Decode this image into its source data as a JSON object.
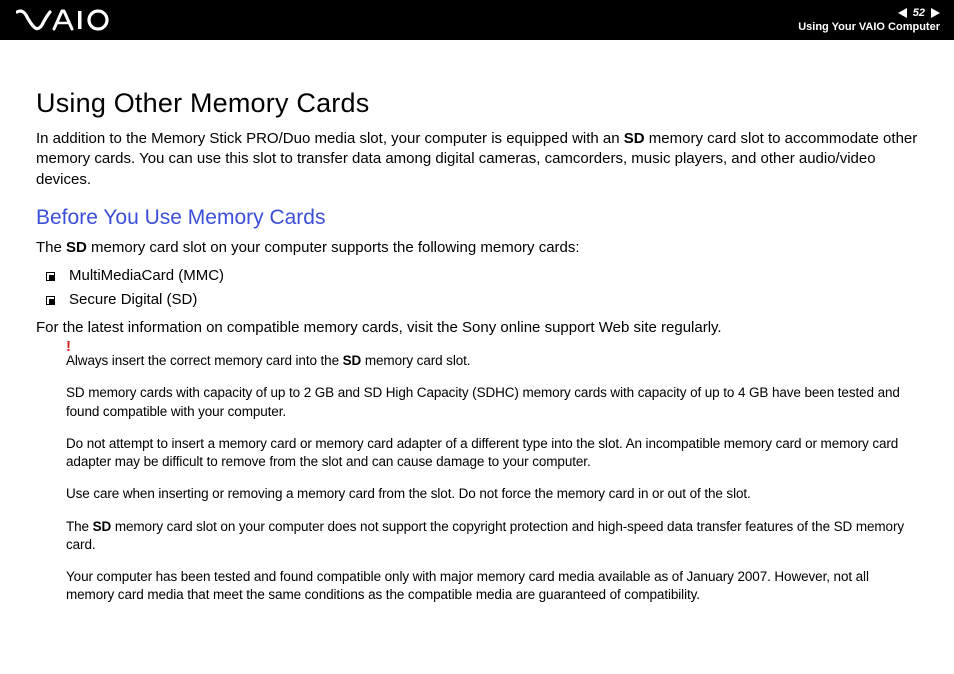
{
  "header": {
    "page_number": "52",
    "breadcrumb": "Using Your VAIO Computer"
  },
  "body": {
    "h1": "Using Other Memory Cards",
    "intro_pre": "In addition to the Memory Stick PRO/Duo media slot, your computer is equipped with an ",
    "intro_bold": "SD",
    "intro_post": " memory card slot to accommodate other memory cards. You can use this slot to transfer data among digital cameras, camcorders, music players, and other audio/video devices.",
    "h2": "Before You Use Memory Cards",
    "support_pre": "The ",
    "support_bold": "SD",
    "support_post": " memory card slot on your computer supports the following memory cards:",
    "bullets": [
      "MultiMediaCard (MMC)",
      "Secure Digital (SD)"
    ],
    "latest_info": "For the latest information on compatible memory cards, visit the Sony online support Web site regularly.",
    "warning_mark": "!",
    "warn1_pre": "Always insert the correct memory card into the ",
    "warn1_bold": "SD",
    "warn1_post": " memory card slot.",
    "warn2": "SD memory cards with capacity of up to 2 GB and SD High Capacity (SDHC) memory cards with capacity of up to 4 GB have been tested and found compatible with your computer.",
    "warn3": "Do not attempt to insert a memory card or memory card adapter of a different type into the slot. An incompatible memory card or memory card adapter may be difficult to remove from the slot and can cause damage to your computer.",
    "warn4": "Use care when inserting or removing a memory card from the slot. Do not force the memory card in or out of the slot.",
    "warn5_pre": "The ",
    "warn5_bold": "SD",
    "warn5_post": " memory card slot on your computer does not support the copyright protection and high-speed data transfer features of the SD memory card.",
    "warn6": "Your computer has been tested and found compatible only with major memory card media available as of January 2007. However, not all memory card media that meet the same conditions as the compatible media are guaranteed of compatibility."
  }
}
